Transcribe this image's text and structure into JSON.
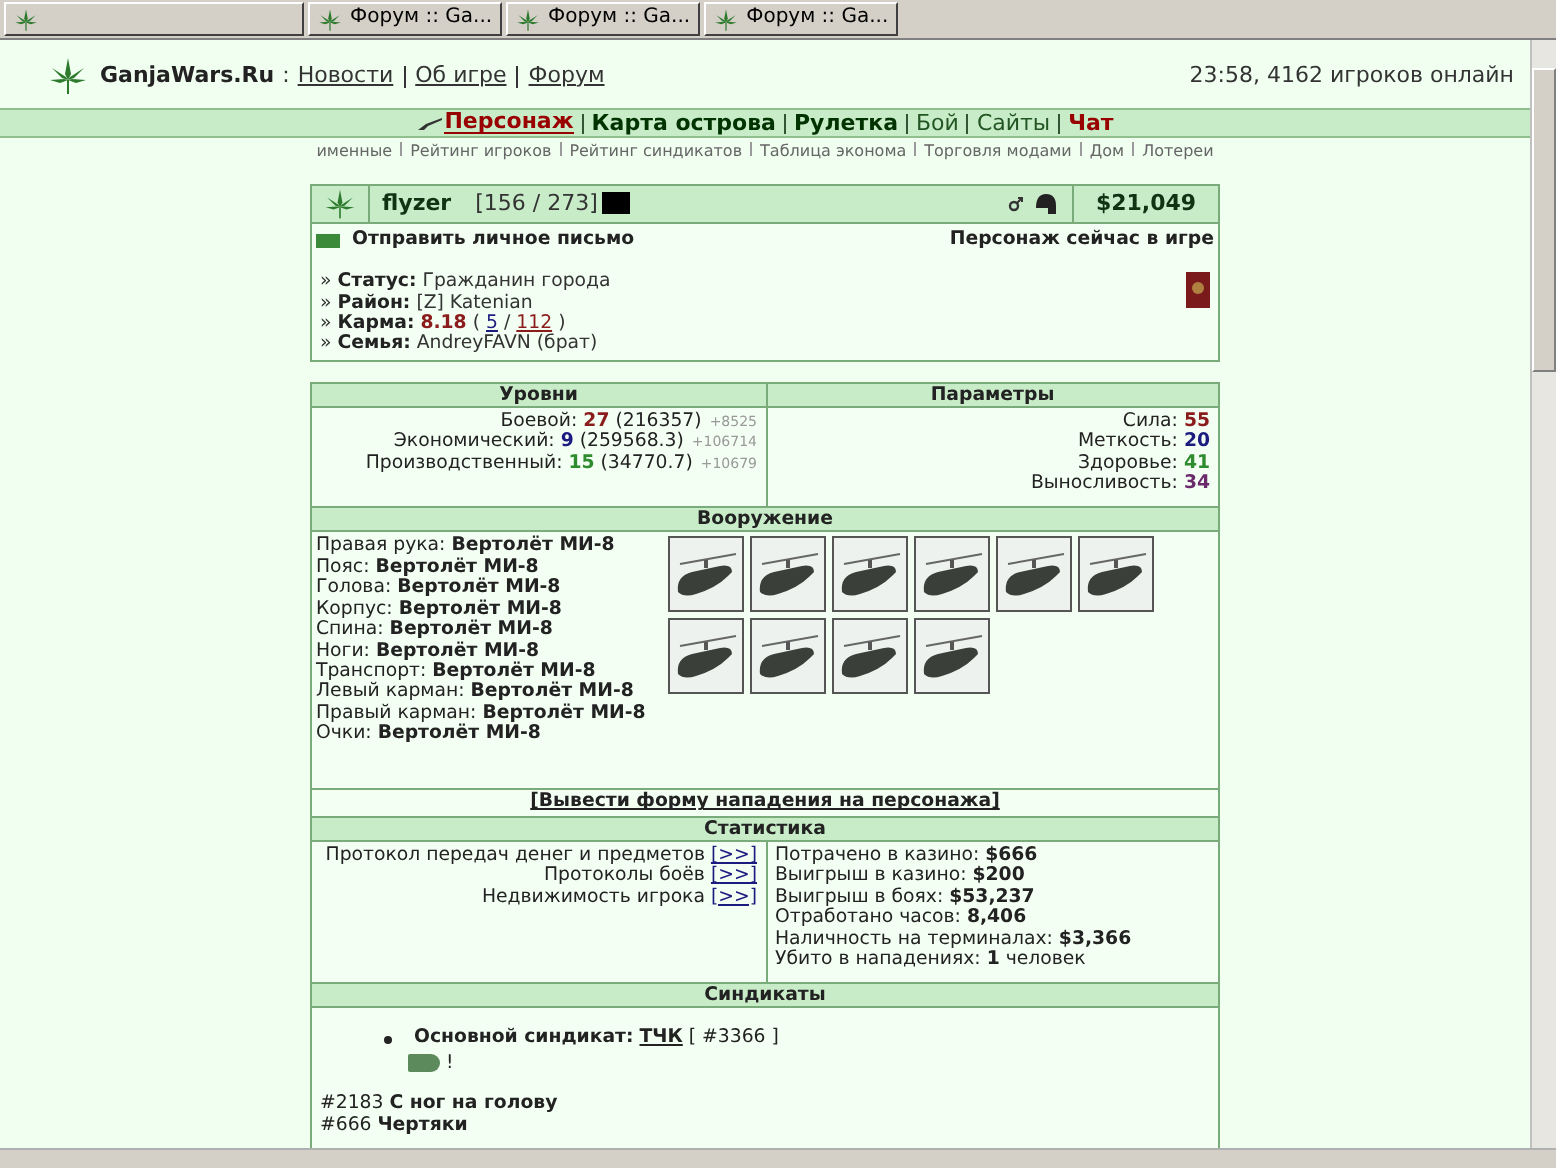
{
  "browser_tabs": [
    "Форум :: Ga...",
    "Форум :: Ga...",
    "Форум :: Ga..."
  ],
  "header": {
    "site_name": "GanjaWars.Ru",
    "separator": ":",
    "links": [
      "Новости",
      "Об игре",
      "Форум"
    ],
    "status": "23:58, 4162 игроков онлайн"
  },
  "nav": [
    {
      "label": "Персонаж",
      "kind": "accent",
      "selected": true
    },
    {
      "label": "Карта острова",
      "kind": "bold",
      "selected": false
    },
    {
      "label": "Рулетка",
      "kind": "bold",
      "selected": false
    },
    {
      "label": "Бой",
      "kind": "plain",
      "selected": false
    },
    {
      "label": "Сайты",
      "kind": "plain",
      "selected": false
    },
    {
      "label": "Чат",
      "kind": "accent",
      "selected": false
    }
  ],
  "subnav": [
    "именные",
    "Рейтинг игроков",
    "Рейтинг синдикатов",
    "Таблица эконома",
    "Торговля модами",
    "Дом",
    "Лотереи"
  ],
  "profile": {
    "name": "flyzer",
    "hp": "[156 / 273]",
    "money": "$21,049",
    "message_link": "Отправить личное письмо",
    "online_status": "Персонаж сейчас в игре",
    "info": [
      [
        {
          "text": "»",
          "kind": "plain"
        },
        {
          "text": "Статус:",
          "kind": "label"
        },
        {
          "text": "Гражданин города",
          "kind": "plain"
        }
      ],
      [
        {
          "text": "»",
          "kind": "plain"
        },
        {
          "text": "Район:",
          "kind": "label"
        },
        {
          "text": "[Z] Katenian",
          "kind": "plain"
        }
      ],
      [
        {
          "text": "»",
          "kind": "plain"
        },
        {
          "text": "Карма:",
          "kind": "label"
        },
        {
          "text": "8.18",
          "kind": "score"
        },
        {
          "text": "(",
          "kind": "plain"
        },
        {
          "text": "5",
          "kind": "link"
        },
        {
          "text": "/",
          "kind": "plain"
        },
        {
          "text": "112",
          "kind": "link_red"
        },
        {
          "text": ")",
          "kind": "plain"
        }
      ],
      [
        {
          "text": "»",
          "kind": "plain"
        },
        {
          "text": "Семья:",
          "kind": "label"
        },
        {
          "text": "AndreyFAVN (брат)",
          "kind": "plain"
        }
      ]
    ]
  },
  "levels": {
    "title": "Уровни",
    "items": [
      {
        "name": "Боевой:",
        "value": "27",
        "color": "#8b1c1c",
        "exp": "(216357)",
        "gain": "+8525"
      },
      {
        "name": "Экономический:",
        "value": "9",
        "color": "#1c1c80",
        "exp": "(259568.3)",
        "gain": "+106714"
      },
      {
        "name": "Производственный:",
        "value": "15",
        "color": "#2e8b2e",
        "exp": "(34770.7)",
        "gain": "+10679"
      }
    ]
  },
  "parameters": {
    "title": "Параметры",
    "items": [
      {
        "name": "Сила:",
        "value": "55",
        "color": "#8b1c1c"
      },
      {
        "name": "Меткость:",
        "value": "20",
        "color": "#1c1c80"
      },
      {
        "name": "Здоровье:",
        "value": "41",
        "color": "#2e8b2e"
      },
      {
        "name": "Выносливость:",
        "value": "34",
        "color": "#6b2a6b"
      }
    ]
  },
  "equipment": {
    "title": "Вооружение",
    "slots": [
      {
        "slot": "Правая рука:",
        "item": "Вертолёт МИ-8"
      },
      {
        "slot": "Пояс:",
        "item": "Вертолёт МИ-8"
      },
      {
        "slot": "Голова:",
        "item": "Вертолёт МИ-8"
      },
      {
        "slot": "Корпус:",
        "item": "Вертолёт МИ-8"
      },
      {
        "slot": "Спина:",
        "item": "Вертолёт МИ-8"
      },
      {
        "slot": "Ноги:",
        "item": "Вертолёт МИ-8"
      },
      {
        "slot": "Транспорт:",
        "item": "Вертолёт МИ-8"
      },
      {
        "slot": "Левый карман:",
        "item": "Вертолёт МИ-8"
      },
      {
        "slot": "Правый карман:",
        "item": "Вертолёт МИ-8"
      },
      {
        "slot": "Очки:",
        "item": "Вертолёт МИ-8"
      }
    ]
  },
  "attack_link": "[Вывести форму нападения на персонажа]",
  "statistics": {
    "title": "Статистика",
    "protocols": [
      {
        "label": "Протокол передач денег и предметов",
        "link": "[>>]"
      },
      {
        "label": "Протоколы боёв",
        "link": "[>>]"
      },
      {
        "label": "Недвижимость игрока",
        "link": "[>>]"
      }
    ],
    "figures": [
      {
        "label": "Потрачено в казино:",
        "value": "$666"
      },
      {
        "label": "Выигрыш в казино:",
        "value": "$200"
      },
      {
        "label": "Выигрыш в боях:",
        "value": "$53,237"
      },
      {
        "label": "Отработано часов:",
        "value": "8,406"
      },
      {
        "label": "Наличность на терминалах:",
        "value": "$3,366"
      },
      {
        "label": "Убито в нападениях:",
        "value": "1",
        "suffix": "человек"
      }
    ]
  },
  "syndicates": {
    "title": "Синдикаты",
    "main": {
      "label": "Основной синдикат:",
      "name": "ТЧК",
      "id": "[ #3366 ]",
      "note": "!"
    },
    "others": [
      {
        "id": "#2183",
        "name": "С ног на голову"
      },
      {
        "id": "#666",
        "name": "Чертяки"
      }
    ]
  }
}
